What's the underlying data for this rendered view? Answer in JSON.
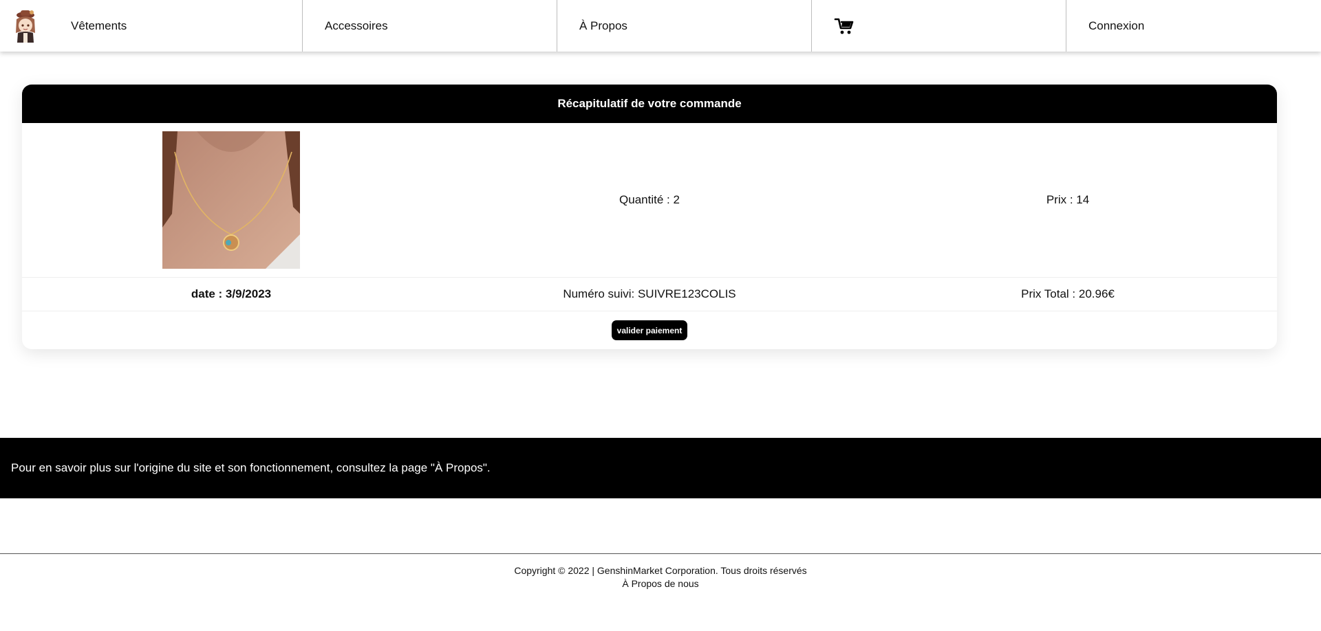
{
  "nav": {
    "items": [
      {
        "label": "Vêtements"
      },
      {
        "label": "Accessoires"
      },
      {
        "label": "À Propos"
      },
      {
        "label": "Connexion"
      }
    ],
    "cart_icon": "shopping-cart-icon",
    "logo": "chibi-character-logo"
  },
  "order": {
    "title": "Récapitulatif de votre commande",
    "product": {
      "image": "gold-necklace-photo",
      "quantity": "Quantité : 2",
      "price": "Prix : 14"
    },
    "date": "date : 3/9/2023",
    "tracking": "Numéro suivi: SUIVRE123COLIS",
    "total": "Prix Total : 20.96€",
    "pay_button": "valider paiement"
  },
  "banner": {
    "text": "Pour en savoir plus sur l'origine du site et son fonctionnement, consultez la page \"À Propos\"."
  },
  "footer": {
    "copyright": "Copyright © 2022 | GenshinMarket Corporation. Tous droits réservés",
    "about_link": "À Propos de nous"
  },
  "colors": {
    "header_bg": "#000000",
    "page_bg": "#ffffff",
    "button_bg": "#000000"
  }
}
